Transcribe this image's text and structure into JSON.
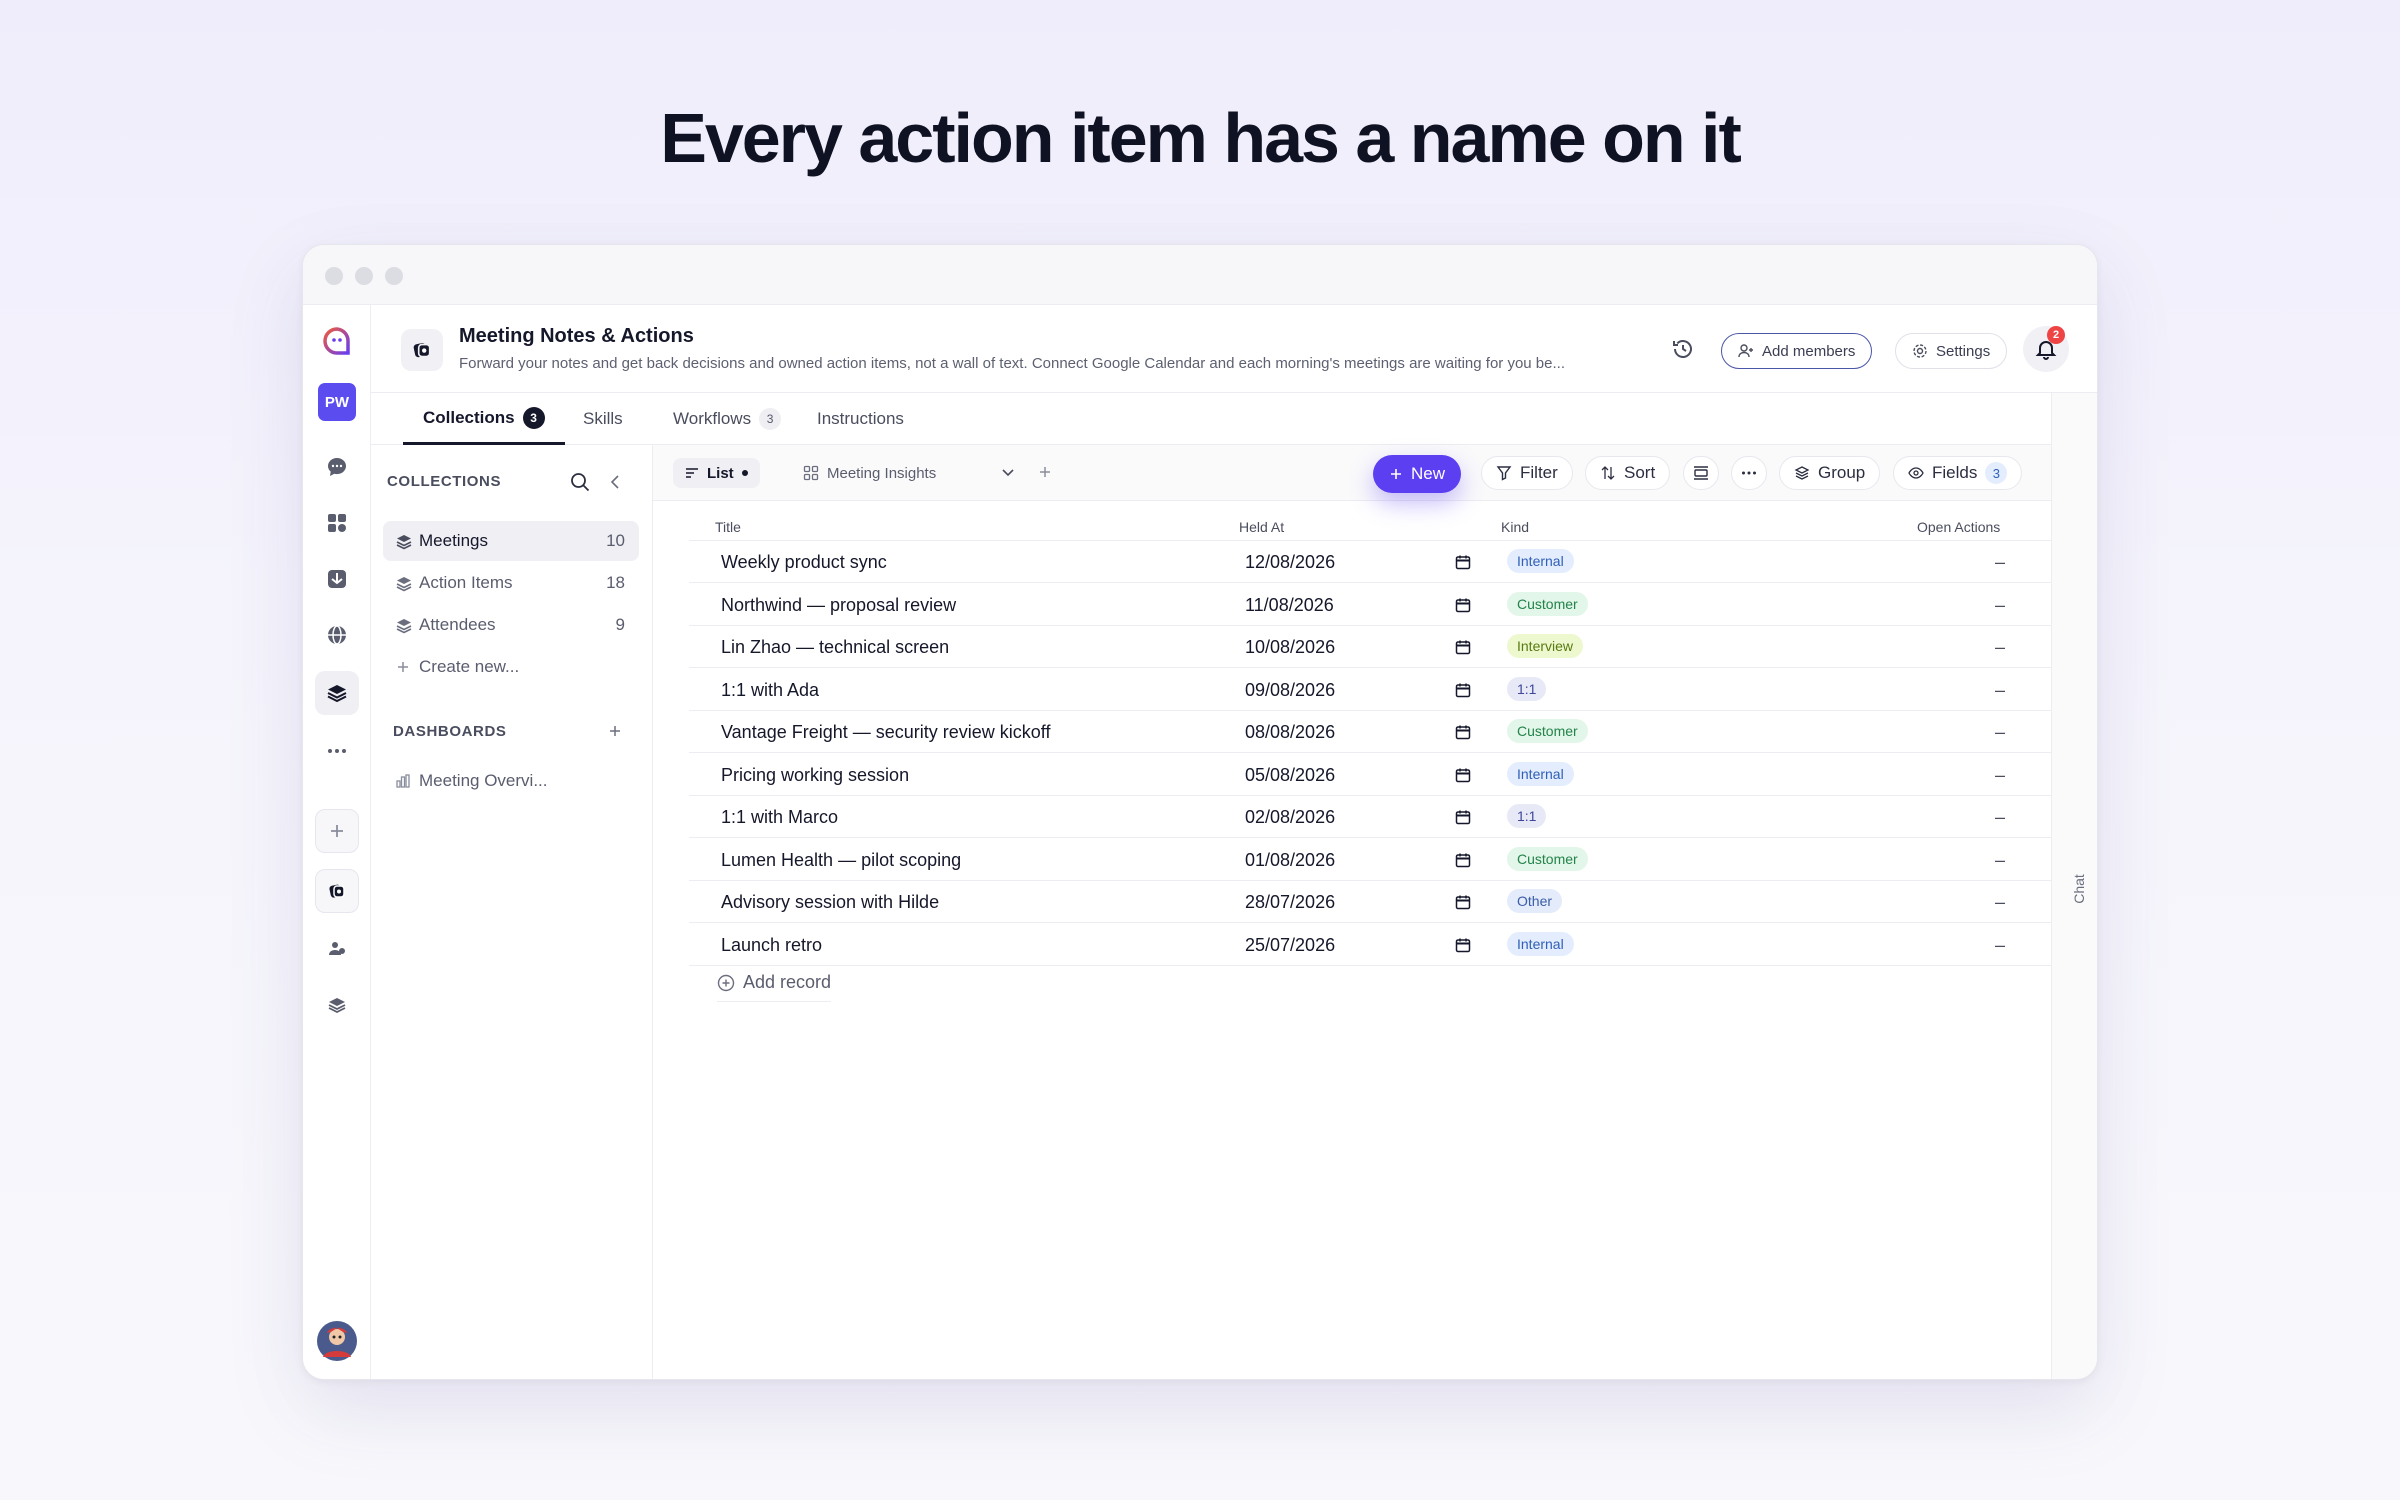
{
  "headline": "Every action item has a name on it",
  "app": {
    "title": "Meeting Notes & Actions",
    "description": "Forward your notes and get back decisions and owned action items, not a wall of text. Connect Google Calendar and each morning's meetings are waiting for you be...",
    "add_members_label": "Add members",
    "settings_label": "Settings",
    "notification_count": "2"
  },
  "rail": {
    "avatar_initials": "PW"
  },
  "tabs": [
    {
      "label": "Collections",
      "count": "3"
    },
    {
      "label": "Skills",
      "count": ""
    },
    {
      "label": "Workflows",
      "count": "3"
    },
    {
      "label": "Instructions",
      "count": ""
    }
  ],
  "chat_label": "Chat",
  "collections_panel": {
    "heading": "COLLECTIONS",
    "items": [
      {
        "label": "Meetings",
        "count": "10"
      },
      {
        "label": "Action Items",
        "count": "18"
      },
      {
        "label": "Attendees",
        "count": "9"
      }
    ],
    "create_label": "Create new...",
    "dashboards_heading": "DASHBOARDS",
    "dashboards": [
      {
        "label": "Meeting Overvi..."
      }
    ]
  },
  "toolbar": {
    "list_label": "List",
    "view_label": "Meeting Insights",
    "new_label": "New",
    "filter_label": "Filter",
    "sort_label": "Sort",
    "group_label": "Group",
    "fields_label": "Fields",
    "fields_count": "3"
  },
  "table": {
    "columns": [
      "Title",
      "Held At",
      "Kind",
      "Open Actions"
    ],
    "rows": [
      {
        "title": "Weekly product sync",
        "held_at": "12/08/2026",
        "kind": "Internal",
        "open": "–"
      },
      {
        "title": "Northwind — proposal review",
        "held_at": "11/08/2026",
        "kind": "Customer",
        "open": "–"
      },
      {
        "title": "Lin Zhao — technical screen",
        "held_at": "10/08/2026",
        "kind": "Interview",
        "open": "–"
      },
      {
        "title": "1:1 with Ada",
        "held_at": "09/08/2026",
        "kind": "1:1",
        "open": "–"
      },
      {
        "title": "Vantage Freight — security review kickoff",
        "held_at": "08/08/2026",
        "kind": "Customer",
        "open": "–"
      },
      {
        "title": "Pricing working session",
        "held_at": "05/08/2026",
        "kind": "Internal",
        "open": "–"
      },
      {
        "title": "1:1 with Marco",
        "held_at": "02/08/2026",
        "kind": "1:1",
        "open": "–"
      },
      {
        "title": "Lumen Health — pilot scoping",
        "held_at": "01/08/2026",
        "kind": "Customer",
        "open": "–"
      },
      {
        "title": "Advisory session with Hilde",
        "held_at": "28/07/2026",
        "kind": "Other",
        "open": "–"
      },
      {
        "title": "Launch retro",
        "held_at": "25/07/2026",
        "kind": "Internal",
        "open": "–"
      }
    ],
    "add_record_label": "Add record"
  },
  "kind_colors": {
    "Internal": {
      "bg": "#e3edfd",
      "fg": "#2f5fb8"
    },
    "Customer": {
      "bg": "#e2f6e9",
      "fg": "#23834a"
    },
    "Interview": {
      "bg": "#eef8cf",
      "fg": "#587a10"
    },
    "1:1": {
      "bg": "#e7e9f7",
      "fg": "#3d4699"
    },
    "Other": {
      "bg": "#e4ecfb",
      "fg": "#3a5ba8"
    }
  },
  "colors": {
    "accent": "#5b3ff0",
    "brand": "#5b4cf0",
    "badge": "#ef4444"
  }
}
